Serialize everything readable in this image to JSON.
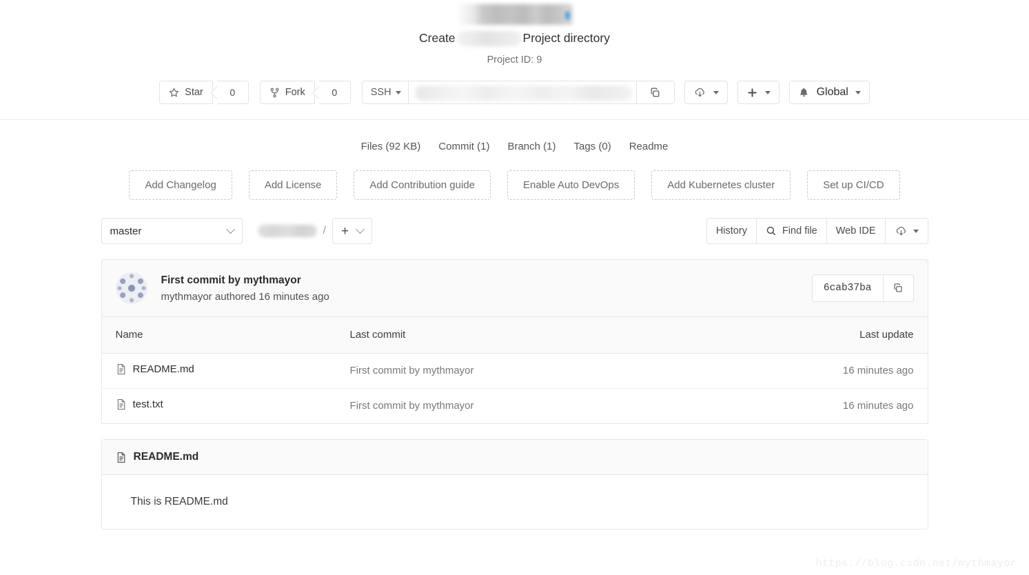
{
  "project": {
    "title_prefix": "Create",
    "title_suffix": "Project directory",
    "project_id_label": "Project ID: 9"
  },
  "toolbar": {
    "star_label": "Star",
    "star_count": "0",
    "fork_label": "Fork",
    "fork_count": "0",
    "clone_protocol": "SSH",
    "copy_url_icon": "copy-icon",
    "download_icon": "download-cloud-icon",
    "plus_icon": "plus-icon",
    "notification_icon": "bell-icon",
    "notification_label": "Global"
  },
  "stats": [
    {
      "label": "Files (92 KB)"
    },
    {
      "label": "Commit (1)"
    },
    {
      "label": "Branch (1)"
    },
    {
      "label": "Tags (0)"
    },
    {
      "label": "Readme"
    }
  ],
  "quick_actions": [
    {
      "label": "Add Changelog"
    },
    {
      "label": "Add License"
    },
    {
      "label": "Add Contribution guide"
    },
    {
      "label": "Enable Auto DevOps"
    },
    {
      "label": "Add Kubernetes cluster"
    },
    {
      "label": "Set up CI/CD"
    }
  ],
  "repo_bar": {
    "branch": "master",
    "path_separator": "/",
    "plus_glyph": "+",
    "history_label": "History",
    "find_file_label": "Find file",
    "find_file_icon": "search-icon",
    "web_ide_label": "Web IDE",
    "download_icon": "download-cloud-icon"
  },
  "commit": {
    "title": "First commit by mythmayor",
    "meta": "mythmayor authored 16 minutes ago",
    "sha": "6cab37ba",
    "copy_icon": "copy-icon",
    "avatar_icon": "identicon-avatar"
  },
  "files_table": {
    "columns": [
      "Name",
      "Last commit",
      "Last update"
    ],
    "rows": [
      {
        "icon": "file-icon",
        "name": "README.md",
        "last_commit": "First commit by mythmayor",
        "last_update": "16 minutes ago"
      },
      {
        "icon": "file-icon",
        "name": "test.txt",
        "last_commit": "First commit by mythmayor",
        "last_update": "16 minutes ago"
      }
    ]
  },
  "readme": {
    "icon": "file-icon",
    "title": "README.md",
    "body": "This is README.md"
  },
  "watermark": "https://blog.csdn.net/mythmayor",
  "colors": {
    "border": "#e6e6e6",
    "panel_bg": "#fafafa",
    "muted_text": "#787878",
    "link": "#1f78d1"
  }
}
